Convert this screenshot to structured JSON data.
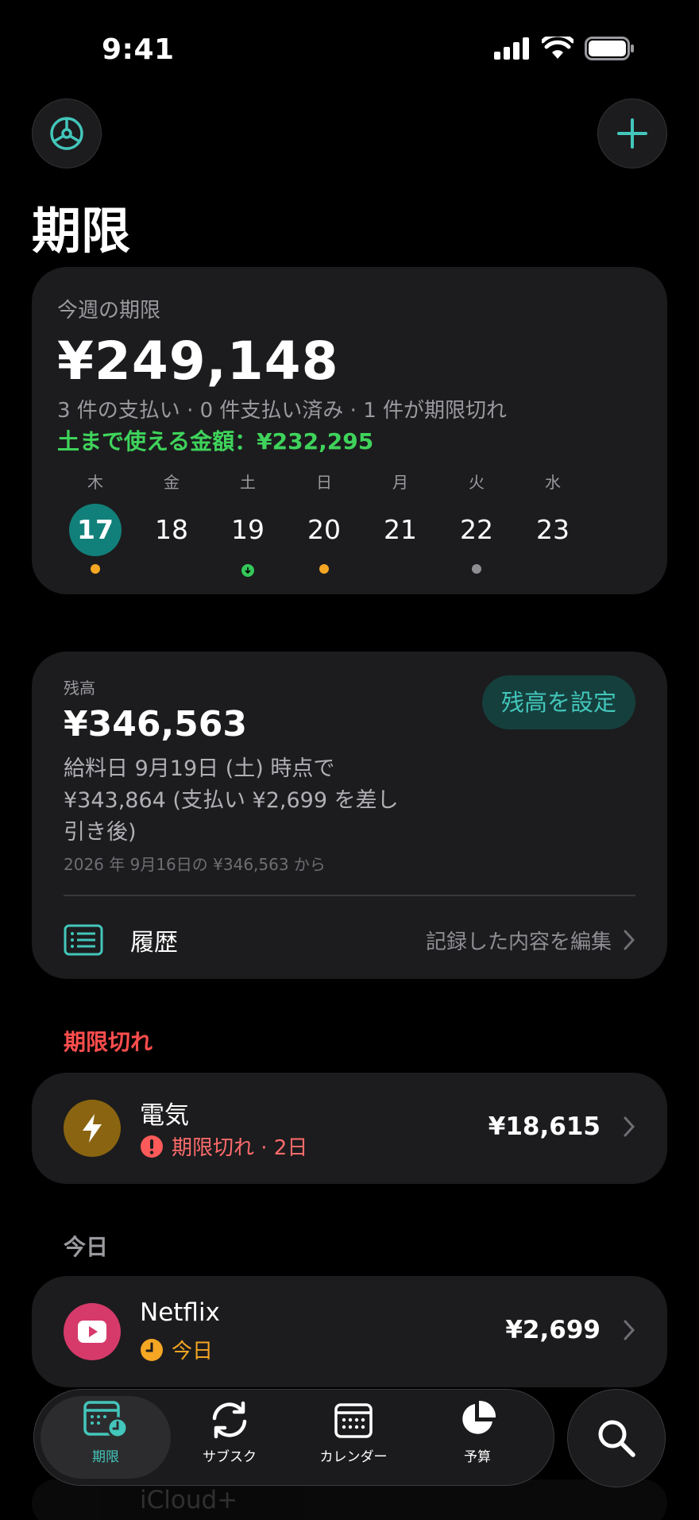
{
  "status_bar": {
    "time": "9:41"
  },
  "page": {
    "title": "期限"
  },
  "week": {
    "label": "今週の期限",
    "total": "¥249,148",
    "summary": "3 件の支払い · 0 件支払い済み · 1 件が期限切れ",
    "available": "土まで使える金額：¥232,295",
    "days": [
      {
        "weekday": "木",
        "day": "17",
        "today": true,
        "marker": "orange"
      },
      {
        "weekday": "金",
        "day": "18",
        "today": false,
        "marker": ""
      },
      {
        "weekday": "土",
        "day": "19",
        "today": false,
        "marker": "green-arrow"
      },
      {
        "weekday": "日",
        "day": "20",
        "today": false,
        "marker": "orange"
      },
      {
        "weekday": "月",
        "day": "21",
        "today": false,
        "marker": ""
      },
      {
        "weekday": "火",
        "day": "22",
        "today": false,
        "marker": "gray"
      },
      {
        "weekday": "水",
        "day": "23",
        "today": false,
        "marker": ""
      }
    ]
  },
  "balance": {
    "label": "残高",
    "value": "¥346,563",
    "set_button": "残高を設定",
    "description": "給料日 9月19日 (土) 時点で ¥343,864 (支払い ¥2,699 を差し引き後)",
    "from": "2026 年 9月16日の ¥346,563 から",
    "history_title": "履歴",
    "history_edit": "記録した内容を編集"
  },
  "sections": {
    "overdue": "期限切れ",
    "today": "今日"
  },
  "items": {
    "electric": {
      "name": "電気",
      "status": "期限切れ · 2日",
      "amount": "¥18,615",
      "icon": "bolt-icon",
      "color": "#8a6410",
      "status_color": "#ff6b6b"
    },
    "netflix": {
      "name": "Netflix",
      "status": "今日",
      "amount": "¥2,699",
      "icon": "play-icon",
      "color": "#d63a6b",
      "status_color": "#f5a623"
    },
    "next": {
      "name": "iCloud+"
    }
  },
  "tabs": [
    {
      "label": "期限",
      "icon": "calendar-clock-icon",
      "active": true
    },
    {
      "label": "サブスク",
      "icon": "refresh-icon",
      "active": false
    },
    {
      "label": "カレンダー",
      "icon": "calendar-icon",
      "active": false
    },
    {
      "label": "予算",
      "icon": "pie-chart-icon",
      "active": false
    }
  ],
  "colors": {
    "accent": "#43c6bb",
    "today_circle": "#12807a",
    "positive": "#3fd35b",
    "danger": "#ff4d4d"
  }
}
